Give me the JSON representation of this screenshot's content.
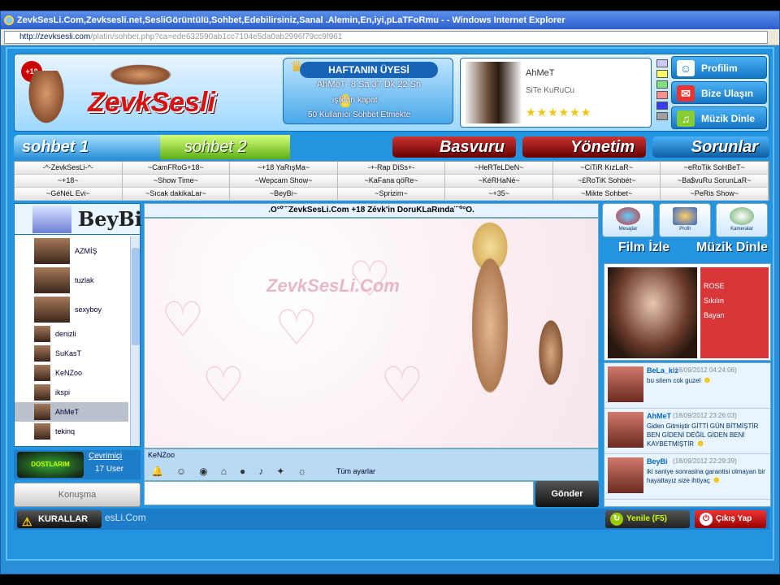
{
  "window": {
    "title": "ZevkSesLi.Com,Zevksesli.net,SesliGörüntülü,Sohbet,Edebilirsiniz,Sanal .Alemin,En,iyi,pLaTFoRmu - - Windows Internet Explorer"
  },
  "address": {
    "host": "http://zevksesli.com",
    "path": "/platin/sohbet.php?ca=ede632590ab1cc7104e5da0ab2996f79cc9f961"
  },
  "header": {
    "age": "+18",
    "logo": "ZevkSesli",
    "week_member": {
      "title": "HAFTANIN ÜYESİ",
      "user_line": "AhMeT -8 Sa 37 Dk 22 Sn",
      "line2": "işikları kapat",
      "line3": "50 Kullanıcı Sohbet Etmekte"
    },
    "featured": {
      "name": "AhMeT",
      "tag": "SiTe KuRuCu",
      "stars": "★★★★★★"
    },
    "colors": [
      "#c9c9ff",
      "#ffff66",
      "#7fe07f",
      "#ff8f8f",
      "#3a3aff",
      "#a0a0a0"
    ],
    "buttons": [
      {
        "label": "Profilim",
        "icon": "user-icon"
      },
      {
        "label": "Bize Ulaşın",
        "icon": "mail-icon"
      },
      {
        "label": "Müzik Dinle",
        "icon": "music-icon"
      }
    ]
  },
  "nav": {
    "tab1": "sohbet 1",
    "tab2": "sohbet 2",
    "basvuru": "Basvuru",
    "yonetim": "Yönetim",
    "sorunlar": "Sorunlar"
  },
  "menu": [
    [
      "-^-ZevkSesLi-^-",
      "~CamFRoG+18~",
      "~+18 YaRışMa~",
      "-+-Rap DiSs+-",
      "~HeRTeLDeN~",
      "~CiTiR KızLaR~",
      "~eRoTik SoHBeT~"
    ],
    [
      "~+18~",
      "~Show Time~",
      "~Wepcam Show~",
      "~KaFana qöRe~",
      "~KéRHaNé~",
      "~£RoTiK Sohbét~",
      "~Ba$vuRu SorunLaR~"
    ],
    [
      "~GéNéL Evi~",
      "~Sıcak dakikaLar~",
      "~BeyBi~",
      "~Sprizim~",
      "~+35~",
      "~Mikte Sohbet~",
      "~PeRis Show~"
    ]
  ],
  "users": {
    "me": "BeyBi",
    "list": [
      {
        "name": "AZMİŞ",
        "big": true
      },
      {
        "name": "tuzlak",
        "big": true
      },
      {
        "name": "sexyboy",
        "big": true
      },
      {
        "name": "denizli",
        "big": false
      },
      {
        "name": "SuKasT",
        "big": false
      },
      {
        "name": "KeNZoo",
        "big": false
      },
      {
        "name": "ikspi",
        "big": false
      },
      {
        "name": "AhMeT",
        "big": false,
        "selected": true
      },
      {
        "name": "tekinq",
        "big": false
      }
    ],
    "vip": "DOSTLARIM",
    "online_label": "Çevrimiçi",
    "count": "17 User",
    "speak": "Konuşma"
  },
  "chat": {
    "header": ".O°º¨¨ZevkSesLi.Com +18 Zévk'in DoruKLaRında¨¨º°O.",
    "watermark": "ZevkSesLi.Com"
  },
  "toolbar": {
    "user": "KeNZoo",
    "settings": "Tüm ayarlar",
    "send": "Gönder"
  },
  "right": {
    "buttons": [
      "Mesajlar",
      "Profil",
      "Kameralar"
    ],
    "film": "Film İzle",
    "muzik": "Müzik Dinle",
    "profile": {
      "name": "ROSE",
      "line2": "Sıkılın",
      "line3": "Bayan"
    },
    "messages": [
      {
        "name": "BeLa_kiz",
        "time": "(18/09/2012 04:24:06)",
        "text": "bu sitem cok guzel"
      },
      {
        "name": "AhMeT",
        "time": "(18/09/2012 23:26:03)",
        "text": "Giden Gitmiştir GİTTİ GÜN BİTMİŞTİR BEN GİDENİ DEĞİL GİDEN BENİ KAYBETMİŞTİR"
      },
      {
        "name": "BeyBi",
        "time": "(18/09/2012 22:29:39)",
        "text": "iki saniye sonrasina garantisi olmayan bir hayattayız size ihtiyaç"
      }
    ]
  },
  "footer": {
    "rules": "KURALLAR",
    "site": "esLi.Com",
    "refresh": "Yenile (F5)",
    "logout": "Çıkış Yap"
  }
}
